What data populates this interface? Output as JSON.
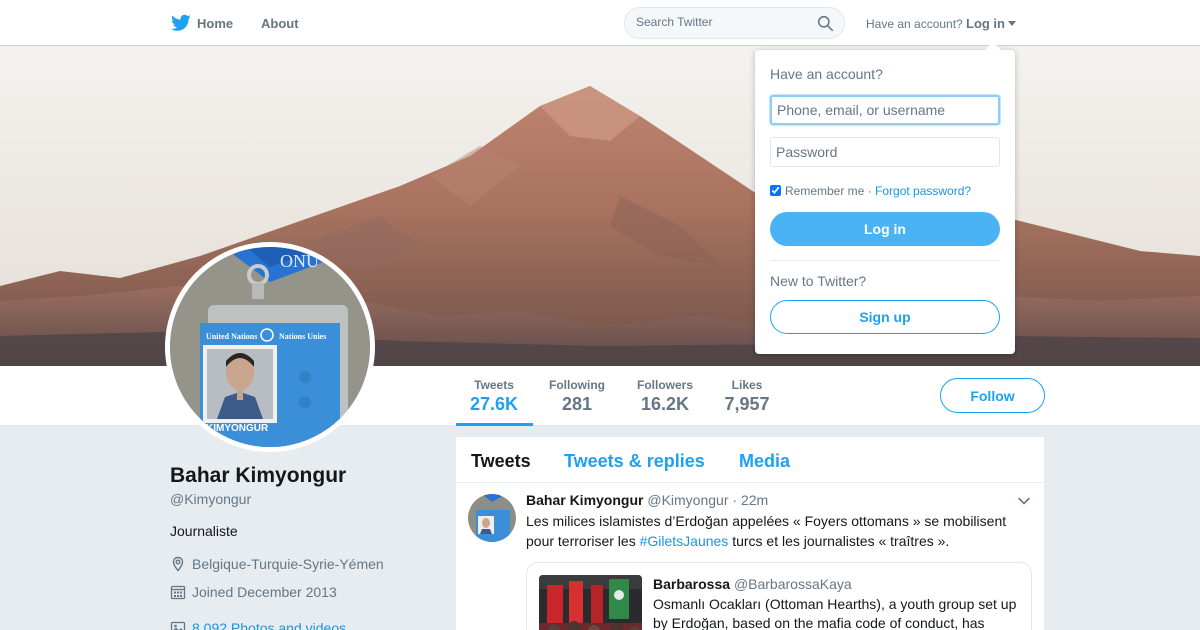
{
  "nav": {
    "home_label": "Home",
    "about_label": "About",
    "search_placeholder": "Search Twitter",
    "have_account": "Have an account?",
    "login_label": "Log in"
  },
  "profile": {
    "name": "Bahar Kimyongur",
    "handle": "@Kimyongur",
    "bio": "Journaliste",
    "location": "Belgique-Turquie-Syrie-Yémen",
    "joined": "Joined December 2013",
    "photos": "8,092 Photos and videos",
    "badge_org_en": "United Nations",
    "badge_org_fr": "Nations Unies",
    "badge_name": "KIMYONGUR",
    "lanyard_text": "ONU"
  },
  "stats": [
    {
      "label": "Tweets",
      "value": "27.6K"
    },
    {
      "label": "Following",
      "value": "281"
    },
    {
      "label": "Followers",
      "value": "16.2K"
    },
    {
      "label": "Likes",
      "value": "7,957"
    }
  ],
  "follow_label": "Follow",
  "timeline": {
    "tabs": [
      {
        "label": "Tweets"
      },
      {
        "label": "Tweets & replies"
      },
      {
        "label": "Media"
      }
    ]
  },
  "tweet": {
    "name": "Bahar Kimyongur",
    "handle": "@Kimyongur",
    "time": "· 22m",
    "text_before": "Les milices islamistes d’Erdoğan appelées « Foyers ottomans » se mobilisent pour terroriser les ",
    "hashtag": "#GiletsJaunes",
    "text_after": " turcs et les journalistes « traîtres ».",
    "quote": {
      "name": "Barbarossa",
      "handle": "@BarbarossaKaya",
      "text": "Osmanlı Ocakları (Ottoman Hearths), a youth group set up by Erdoğan, based on the mafia code of conduct, has"
    }
  },
  "login_dropdown": {
    "title": "Have an account?",
    "username_placeholder": "Phone, email, or username",
    "password_placeholder": "Password",
    "remember_label": "Remember me",
    "separator": " · ",
    "forgot_label": "Forgot password?",
    "remember_checked": true,
    "login_button": "Log in",
    "new_label": "New to Twitter?",
    "signup_button": "Sign up"
  },
  "colors": {
    "accent": "#1da1f2",
    "link": "#1b95e0",
    "login_button": "#4ab3f4",
    "muted": "#657786",
    "background": "#e6ecf0"
  },
  "icons": [
    "twitter-bird-icon",
    "search-icon",
    "caret-down-icon",
    "location-icon",
    "calendar-icon",
    "photo-icon",
    "chevron-down-icon"
  ]
}
